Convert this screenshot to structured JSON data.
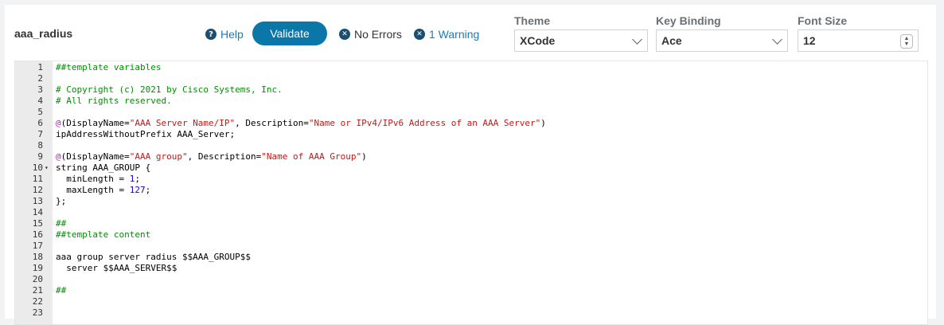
{
  "header": {
    "title": "aaa_radius",
    "help_label": "Help",
    "validate_label": "Validate",
    "errors_label": "No Errors",
    "warnings_label": "1 Warning"
  },
  "settings": {
    "theme": {
      "label": "Theme",
      "value": "XCode"
    },
    "key_binding": {
      "label": "Key Binding",
      "value": "Ace"
    },
    "font_size": {
      "label": "Font Size",
      "value": "12"
    }
  },
  "editor": {
    "line_numbers": [
      "1",
      "2",
      "3",
      "4",
      "5",
      "6",
      "7",
      "8",
      "9",
      "10",
      "11",
      "12",
      "13",
      "14",
      "15",
      "16",
      "17",
      "18",
      "19",
      "20",
      "21",
      "22",
      "23"
    ],
    "folded_line": "10",
    "lines": [
      [
        {
          "t": "##template variables",
          "c": "comment"
        }
      ],
      [],
      [
        {
          "t": "# Copyright (c) 2021 by Cisco Systems, Inc.",
          "c": "comment"
        }
      ],
      [
        {
          "t": "# All rights reserved.",
          "c": "comment"
        }
      ],
      [],
      [
        {
          "t": "@",
          "c": "at"
        },
        {
          "t": "(DisplayName=",
          "c": "plain"
        },
        {
          "t": "\"AAA Server Name/IP\"",
          "c": "str"
        },
        {
          "t": ", Description=",
          "c": "plain"
        },
        {
          "t": "\"Name or IPv4/IPv6 Address of an AAA Server\"",
          "c": "str"
        },
        {
          "t": ")",
          "c": "plain"
        }
      ],
      [
        {
          "t": "ipAddressWithoutPrefix AAA_Server;",
          "c": "plain"
        }
      ],
      [],
      [
        {
          "t": "@",
          "c": "at"
        },
        {
          "t": "(DisplayName=",
          "c": "plain"
        },
        {
          "t": "\"AAA group\"",
          "c": "str"
        },
        {
          "t": ", Description=",
          "c": "plain"
        },
        {
          "t": "\"Name of AAA Group\"",
          "c": "str"
        },
        {
          "t": ")",
          "c": "plain"
        }
      ],
      [
        {
          "t": "string AAA_GROUP {",
          "c": "plain"
        }
      ],
      [
        {
          "t": "  minLength = ",
          "c": "plain"
        },
        {
          "t": "1",
          "c": "num"
        },
        {
          "t": ";",
          "c": "plain"
        }
      ],
      [
        {
          "t": "  maxLength = ",
          "c": "plain"
        },
        {
          "t": "127",
          "c": "num"
        },
        {
          "t": ";",
          "c": "plain"
        }
      ],
      [
        {
          "t": "};",
          "c": "plain"
        }
      ],
      [],
      [
        {
          "t": "##",
          "c": "comment"
        }
      ],
      [
        {
          "t": "##template content",
          "c": "comment"
        }
      ],
      [],
      [
        {
          "t": "aaa group server radius $$AAA_GROUP$$",
          "c": "plain"
        }
      ],
      [
        {
          "t": "  server $$AAA_SERVER$$",
          "c": "plain"
        }
      ],
      [],
      [
        {
          "t": "##",
          "c": "comment"
        }
      ],
      [],
      []
    ]
  }
}
